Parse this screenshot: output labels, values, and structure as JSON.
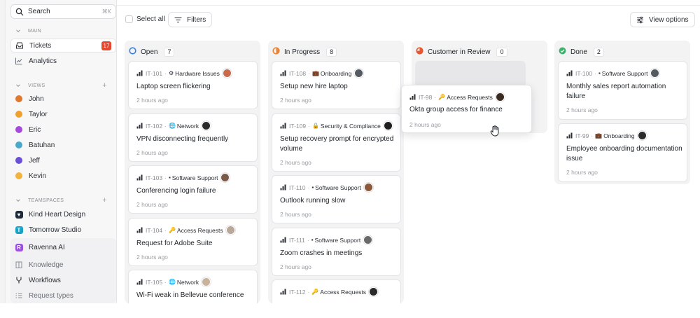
{
  "sidebar": {
    "search": {
      "label": "Search",
      "shortcut": "⌘K"
    },
    "sections": {
      "main": "MAIN",
      "views": "VIEWS",
      "teamspaces": "TEAMSPACES"
    },
    "main_items": [
      {
        "label": "Tickets",
        "icon": "inbox-icon",
        "badge": "17"
      },
      {
        "label": "Analytics",
        "icon": "chart-line-icon"
      }
    ],
    "views": [
      {
        "label": "John",
        "color": "#e0782e"
      },
      {
        "label": "Taylor",
        "color": "#f0a02e"
      },
      {
        "label": "Eric",
        "color": "#a64ad9"
      },
      {
        "label": "Batuhan",
        "color": "#4aa8c9"
      },
      {
        "label": "Jeff",
        "color": "#6b4fd6"
      },
      {
        "label": "Kevin",
        "color": "#f2b33d"
      }
    ],
    "teamspaces": [
      {
        "label": "Kind Heart Design",
        "letter": "",
        "color": "#1e2a3a"
      },
      {
        "label": "Tomorrow Studio",
        "letter": "T",
        "color": "#1aa3c9"
      },
      {
        "label": "Ravenna AI",
        "letter": "R",
        "color": "#9b4fe0"
      }
    ],
    "sub_items": [
      {
        "label": "Knowledge",
        "icon": "book-icon"
      },
      {
        "label": "Workflows",
        "icon": "workflow-icon"
      },
      {
        "label": "Request types",
        "icon": "list-icon"
      }
    ]
  },
  "toolbar": {
    "select_all": "Select all",
    "filters": "Filters",
    "view_options": "View options"
  },
  "columns": [
    {
      "title": "Open",
      "count": "7",
      "status_color": "#3b7de0",
      "cards": [
        {
          "id": "IT-101",
          "category": "Hardware Issues",
          "cat_icon": "⚙",
          "title": "Laptop screen flickering",
          "time": "2 hours ago",
          "avatar": "#c96a4a"
        },
        {
          "id": "IT-102",
          "category": "Network",
          "cat_icon": "🌐",
          "title": "VPN disconnecting frequently",
          "time": "2 hours ago",
          "avatar": "#2a2a2a"
        },
        {
          "id": "IT-103",
          "category": "Software Support",
          "cat_icon": "▪",
          "title": "Conferencing login failure",
          "time": "2 hours ago",
          "avatar": "#7a5a48"
        },
        {
          "id": "IT-104",
          "category": "Access Requests",
          "cat_icon": "🔑",
          "title": "Request for Adobe Suite",
          "time": "2 hours ago",
          "avatar": "#b8a89a"
        },
        {
          "id": "IT-105",
          "category": "Network",
          "cat_icon": "🌐",
          "title": "Wi-Fi weak in Bellevue conference",
          "time": "",
          "avatar": "#c9b29a"
        }
      ]
    },
    {
      "title": "In Progress",
      "count": "8",
      "status_color": "#e8833a",
      "cards": [
        {
          "id": "IT-108",
          "category": "Onboarding",
          "cat_icon": "💼",
          "title": "Setup new hire laptop",
          "time": "2 hours ago",
          "avatar": "#555a60"
        },
        {
          "id": "IT-109",
          "category": "Security & Compliance",
          "cat_icon": "🔒",
          "title": "Setup recovery prompt for encrypted volume",
          "time": "2 hours ago",
          "avatar": "#1f1f1f"
        },
        {
          "id": "IT-110",
          "category": "Software Support",
          "cat_icon": "▪",
          "title": "Outlook running slow",
          "time": "2 hours ago",
          "avatar": "#8a5a3a"
        },
        {
          "id": "IT-111",
          "category": "Software Support",
          "cat_icon": "▪",
          "title": "Zoom crashes in meetings",
          "time": "2 hours ago",
          "avatar": "#6a6a6a"
        },
        {
          "id": "IT-112",
          "category": "Access Requests",
          "cat_icon": "🔑",
          "title": "",
          "time": "",
          "avatar": "#2a2a2a"
        }
      ]
    },
    {
      "title": "Customer in Review",
      "count": "0",
      "status_color": "#e8552f",
      "cards": []
    },
    {
      "title": "Done",
      "count": "2",
      "status_color": "#3bb46b",
      "cards": [
        {
          "id": "IT-100",
          "category": "Software Support",
          "cat_icon": "▪",
          "title": "Monthly sales report automation failure",
          "time": "2 hours ago",
          "avatar": "#555a60"
        },
        {
          "id": "IT-99",
          "category": "Onboarding",
          "cat_icon": "💼",
          "title": "Employee onboarding documentation issue",
          "time": "2 hours ago",
          "avatar": "#2a2a2a"
        }
      ]
    }
  ],
  "dragging_card": {
    "id": "IT-98",
    "category": "Access Requests",
    "cat_icon": "🔑",
    "title": "Okta group access for finance",
    "time": "2 hours ago",
    "avatar": "#3a2a22"
  }
}
